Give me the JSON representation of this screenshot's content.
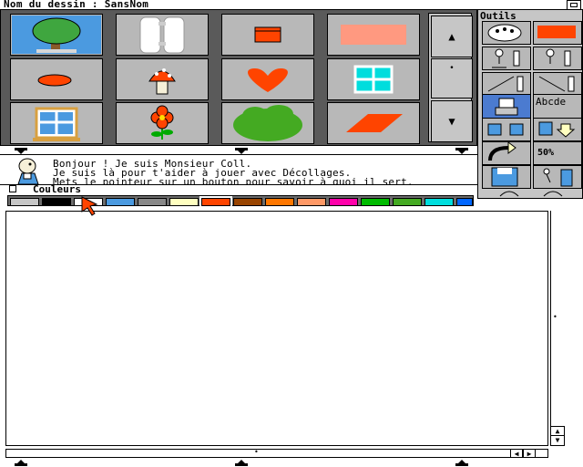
{
  "window": {
    "title": "Nom du dessin : SansNom"
  },
  "gallery": {
    "items": [
      "tree-icon",
      "door-icon",
      "box-icon",
      "rectangle-icon",
      "ellipse-icon",
      "mushroom-icon",
      "heart-icon",
      "window-icon",
      "framed-window-icon",
      "flower-icon",
      "bush-icon",
      "parallelogram-icon"
    ],
    "scroll": {
      "up": "▲",
      "down": "▼"
    }
  },
  "help": {
    "line1": "Bonjour ! Je suis Monsieur Coll.",
    "line2": "Je suis là pour t'aider à jouer avec Décollages.",
    "line3": "Mets le pointeur sur un bouton pour savoir à quoi il sert."
  },
  "colors": {
    "title": "Couleurs",
    "swatches": [
      "#c6c6c6",
      "#000000",
      "#ffffff",
      "#4b9ae0",
      "#888888",
      "#ffffc0",
      "#ff4400",
      "#994400",
      "#ff7700",
      "#ff9966",
      "#ff00aa",
      "#00bb00",
      "#44aa22",
      "#00dddd",
      "#0066ff",
      "#2200aa"
    ]
  },
  "tools": {
    "title": "Outils",
    "sample_text": "Abcde",
    "zoom": "50%",
    "current_color": "#ff4400"
  }
}
